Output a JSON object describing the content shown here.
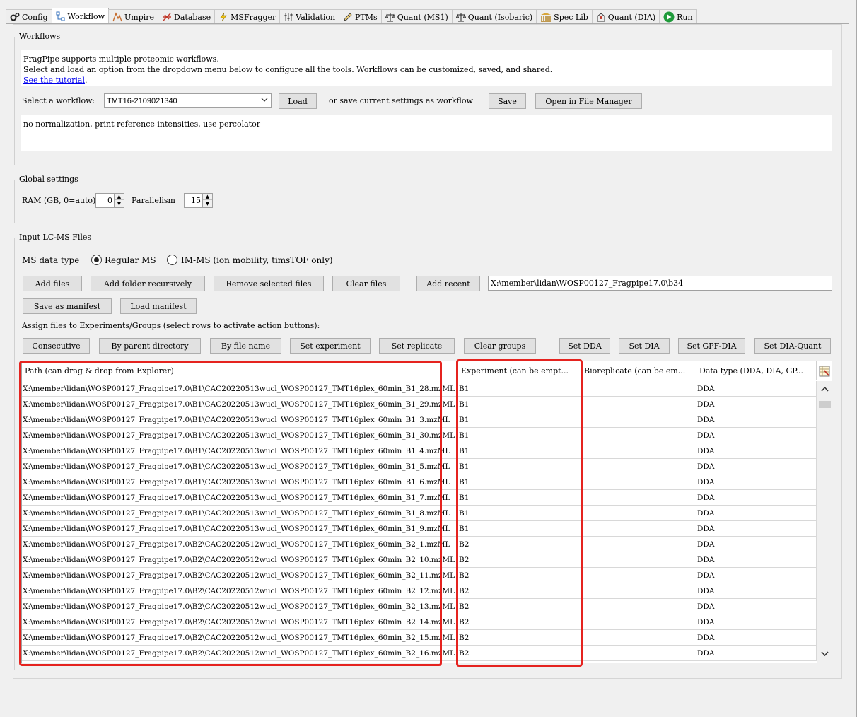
{
  "tabs": [
    {
      "label": "Config",
      "icon": "gear-icon"
    },
    {
      "label": "Workflow",
      "icon": "workflow-icon",
      "active": true
    },
    {
      "label": "Umpire",
      "icon": "umpire-icon"
    },
    {
      "label": "Database",
      "icon": "database-icon"
    },
    {
      "label": "MSFragger",
      "icon": "lightning-icon"
    },
    {
      "label": "Validation",
      "icon": "sliders-icon"
    },
    {
      "label": "PTMs",
      "icon": "pencil-icon"
    },
    {
      "label": "Quant (MS1)",
      "icon": "scale-icon"
    },
    {
      "label": "Quant (Isobaric)",
      "icon": "scale-icon"
    },
    {
      "label": "Spec Lib",
      "icon": "library-icon"
    },
    {
      "label": "Quant (DIA)",
      "icon": "dia-icon"
    },
    {
      "label": "Run",
      "icon": "play-icon"
    }
  ],
  "workflows": {
    "title": "Workflows",
    "intro_line1": "FragPipe supports multiple proteomic workflows.",
    "intro_line2": "Select and load an option from the dropdown menu below to configure all the tools. Workflows can be customized, saved, and shared.",
    "tutorial_link": "See the tutorial",
    "tutorial_period": ".",
    "select_label": "Select a workflow:",
    "selected_workflow": "TMT16-2109021340",
    "load_button": "Load",
    "save_text": "or save current settings as workflow",
    "save_button": "Save",
    "open_manager_button": "Open in File Manager",
    "description": "no normalization, print reference intensities, use percolator"
  },
  "global": {
    "title": "Global settings",
    "ram_label": "RAM (GB, 0=auto)",
    "ram_value": "0",
    "parallelism_label": "Parallelism",
    "parallelism_value": "15"
  },
  "input": {
    "title": "Input LC-MS Files",
    "ms_type_label": "MS data type",
    "regular_ms": "Regular MS",
    "im_ms": "IM-MS (ion mobility, timsTOF only)",
    "add_files": "Add files",
    "add_folder": "Add folder recursively",
    "remove_selected": "Remove selected files",
    "clear_files": "Clear files",
    "add_recent": "Add recent",
    "recent_path": "X:\\member\\lidan\\WOSP00127_Fragpipe17.0\\b34",
    "save_manifest": "Save as manifest",
    "load_manifest": "Load manifest",
    "assign_text": "Assign files to Experiments/Groups (select rows to activate action buttons):",
    "consecutive": "Consecutive",
    "by_parent": "By parent directory",
    "by_file_name": "By file name",
    "set_experiment": "Set experiment",
    "set_replicate": "Set replicate",
    "clear_groups": "Clear groups",
    "set_dda": "Set DDA",
    "set_dia": "Set DIA",
    "set_gpf_dia": "Set GPF-DIA",
    "set_dia_quant": "Set DIA-Quant"
  },
  "table": {
    "headers": [
      "Path (can drag & drop from Explorer)",
      "Experiment (can be empt...",
      "Bioreplicate (can be em...",
      "Data type (DDA, DIA, GP..."
    ],
    "rows": [
      [
        "X:\\member\\lidan\\WOSP00127_Fragpipe17.0\\B1\\CAC20220513wucl_WOSP00127_TMT16plex_60min_B1_28.mzML",
        "B1",
        "",
        "DDA"
      ],
      [
        "X:\\member\\lidan\\WOSP00127_Fragpipe17.0\\B1\\CAC20220513wucl_WOSP00127_TMT16plex_60min_B1_29.mzML",
        "B1",
        "",
        "DDA"
      ],
      [
        "X:\\member\\lidan\\WOSP00127_Fragpipe17.0\\B1\\CAC20220513wucl_WOSP00127_TMT16plex_60min_B1_3.mzML",
        "B1",
        "",
        "DDA"
      ],
      [
        "X:\\member\\lidan\\WOSP00127_Fragpipe17.0\\B1\\CAC20220513wucl_WOSP00127_TMT16plex_60min_B1_30.mzML",
        "B1",
        "",
        "DDA"
      ],
      [
        "X:\\member\\lidan\\WOSP00127_Fragpipe17.0\\B1\\CAC20220513wucl_WOSP00127_TMT16plex_60min_B1_4.mzML",
        "B1",
        "",
        "DDA"
      ],
      [
        "X:\\member\\lidan\\WOSP00127_Fragpipe17.0\\B1\\CAC20220513wucl_WOSP00127_TMT16plex_60min_B1_5.mzML",
        "B1",
        "",
        "DDA"
      ],
      [
        "X:\\member\\lidan\\WOSP00127_Fragpipe17.0\\B1\\CAC20220513wucl_WOSP00127_TMT16plex_60min_B1_6.mzML",
        "B1",
        "",
        "DDA"
      ],
      [
        "X:\\member\\lidan\\WOSP00127_Fragpipe17.0\\B1\\CAC20220513wucl_WOSP00127_TMT16plex_60min_B1_7.mzML",
        "B1",
        "",
        "DDA"
      ],
      [
        "X:\\member\\lidan\\WOSP00127_Fragpipe17.0\\B1\\CAC20220513wucl_WOSP00127_TMT16plex_60min_B1_8.mzML",
        "B1",
        "",
        "DDA"
      ],
      [
        "X:\\member\\lidan\\WOSP00127_Fragpipe17.0\\B1\\CAC20220513wucl_WOSP00127_TMT16plex_60min_B1_9.mzML",
        "B1",
        "",
        "DDA"
      ],
      [
        "X:\\member\\lidan\\WOSP00127_Fragpipe17.0\\B2\\CAC20220512wucl_WOSP00127_TMT16plex_60min_B2_1.mzML",
        "B2",
        "",
        "DDA"
      ],
      [
        "X:\\member\\lidan\\WOSP00127_Fragpipe17.0\\B2\\CAC20220512wucl_WOSP00127_TMT16plex_60min_B2_10.mzML",
        "B2",
        "",
        "DDA"
      ],
      [
        "X:\\member\\lidan\\WOSP00127_Fragpipe17.0\\B2\\CAC20220512wucl_WOSP00127_TMT16plex_60min_B2_11.mzML",
        "B2",
        "",
        "DDA"
      ],
      [
        "X:\\member\\lidan\\WOSP00127_Fragpipe17.0\\B2\\CAC20220512wucl_WOSP00127_TMT16plex_60min_B2_12.mzML",
        "B2",
        "",
        "DDA"
      ],
      [
        "X:\\member\\lidan\\WOSP00127_Fragpipe17.0\\B2\\CAC20220512wucl_WOSP00127_TMT16plex_60min_B2_13.mzML",
        "B2",
        "",
        "DDA"
      ],
      [
        "X:\\member\\lidan\\WOSP00127_Fragpipe17.0\\B2\\CAC20220512wucl_WOSP00127_TMT16plex_60min_B2_14.mzML",
        "B2",
        "",
        "DDA"
      ],
      [
        "X:\\member\\lidan\\WOSP00127_Fragpipe17.0\\B2\\CAC20220512wucl_WOSP00127_TMT16plex_60min_B2_15.mzML",
        "B2",
        "",
        "DDA"
      ],
      [
        "X:\\member\\lidan\\WOSP00127_Fragpipe17.0\\B2\\CAC20220512wucl_WOSP00127_TMT16plex_60min_B2_16.mzML",
        "B2",
        "",
        "DDA"
      ]
    ]
  },
  "colors": {
    "highlight": "#e5231f",
    "link": "#0000ee"
  }
}
